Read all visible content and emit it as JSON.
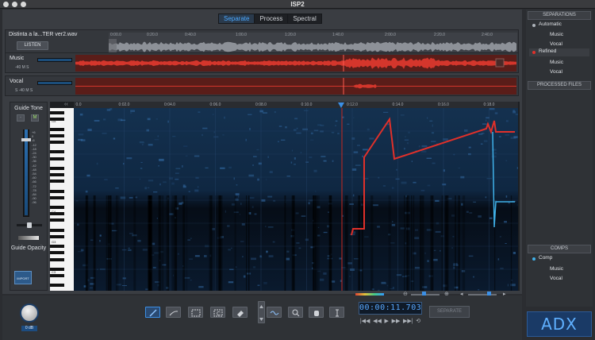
{
  "window": {
    "title": "ISP2"
  },
  "tabs": [
    {
      "label": "Separate",
      "active": true
    },
    {
      "label": "Process",
      "active": false
    },
    {
      "label": "Spectral",
      "active": false
    }
  ],
  "source": {
    "filename": "Distinta a la...TER ver2.wav",
    "listen_label": "LISTEN",
    "ruler": [
      "0:00.0",
      "0:20.0",
      "0:40.0",
      "1:00.0",
      "1:20.0",
      "1:40.0",
      "2:00.0",
      "2:20.0",
      "2:40.0"
    ]
  },
  "tracks": [
    {
      "label": "Music",
      "controls": "-40  M  S",
      "color": "#c8281f"
    },
    {
      "label": "Vocal",
      "controls": "S    -40  M  S",
      "color": "#c8281f"
    }
  ],
  "guide_tone": {
    "title": "Guide Tone",
    "mute_label": "M",
    "scale": [
      "+6",
      "0",
      "-6",
      "-12",
      "-18",
      "-24",
      "-30",
      "-36",
      "-42",
      "-48",
      "-54",
      "-60",
      "-66",
      "-72",
      "-78",
      "-84",
      "-90",
      "-96"
    ],
    "opacity_label": "Guide Opacity",
    "import_label": "IMPORT"
  },
  "spectrogram": {
    "ruler": [
      "0.0",
      "0:02.0",
      "0:04.0",
      "0:06.0",
      "0:08.0",
      "0:10.0",
      "0:12.0",
      "0:14.0",
      "0:16.0",
      "0:18.0"
    ],
    "key_labels": [
      "G5",
      "C5",
      "G4",
      "C4",
      "G3",
      "C3"
    ],
    "pitch_color": "#e0302a",
    "alt_color": "#3fb0e8",
    "background": "#0b1624"
  },
  "bottom": {
    "knob_label": "0 dB",
    "time": "00:00:11.703",
    "transport": [
      "|◀◀",
      "◀◀",
      "▶",
      "▶▶",
      "▶▶|",
      "⟲"
    ],
    "separate_label": "SEPARATE"
  },
  "right_panel": {
    "separations_header": "SEPARATIONS",
    "automatic": {
      "label": "Automatic",
      "children": [
        "Music",
        "Vocal"
      ]
    },
    "refined": {
      "label": "Refined",
      "children": [
        "Music",
        "Vocal"
      ]
    },
    "processed_header": "PROCESSED FILES",
    "comps_header": "COMPS",
    "comp": {
      "label": "Comp",
      "children": [
        "Music",
        "Vocal"
      ]
    }
  },
  "brand": {
    "logo": "ADX",
    "accent": "#3b8fe6"
  }
}
